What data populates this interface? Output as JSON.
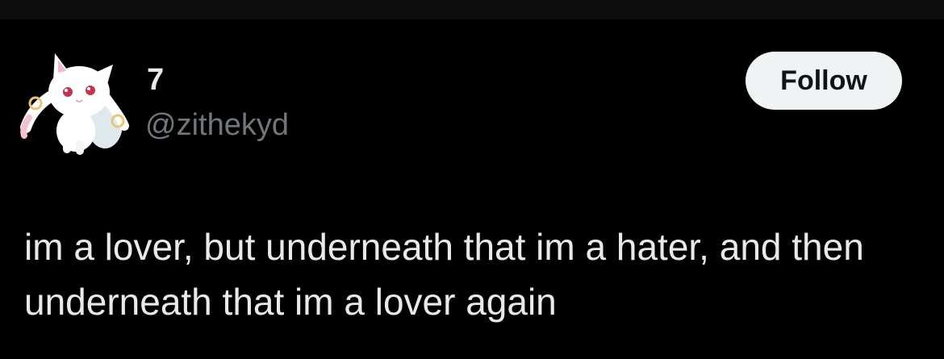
{
  "author": {
    "display_name": "7",
    "handle": "@zithekyd",
    "avatar_icon": "white-cat-creature-avatar"
  },
  "actions": {
    "follow_label": "Follow"
  },
  "tweet": {
    "text": "im a lover, but underneath that im a hater, and then underneath that im a lover again"
  },
  "colors": {
    "background": "#000000",
    "text_primary": "#e7e9ea",
    "text_secondary": "#71767b",
    "button_bg": "#eff3f4",
    "button_text": "#0f1419"
  }
}
